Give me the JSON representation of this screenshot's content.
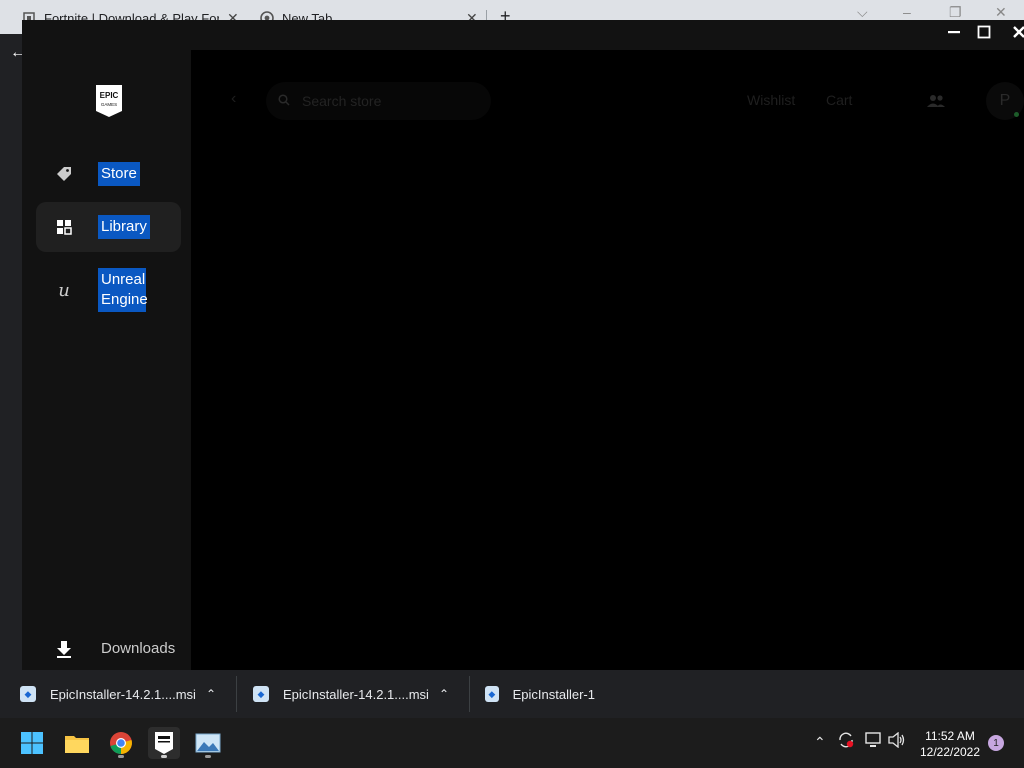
{
  "chrome": {
    "tabs": [
      {
        "title": "Fortnite | Download & Play For F",
        "favicon": "fortnite-icon"
      },
      {
        "title": "New Tab",
        "favicon": "chrome-icon"
      }
    ],
    "new_tab_glyph": "+"
  },
  "epic": {
    "logo_text": "EPIC",
    "logo_sub": "GAMES",
    "sidebar": {
      "items": [
        {
          "label": "Store",
          "icon": "tag-icon"
        },
        {
          "label": "Library",
          "icon": "grid-icon"
        },
        {
          "label": "Unreal Engine",
          "icon": "unreal-icon"
        }
      ],
      "downloads_label": "Downloads"
    },
    "header": {
      "search_placeholder": "Search store",
      "wishlist": "Wishlist",
      "cart": "Cart",
      "avatar_letter": "P"
    }
  },
  "downloads_bar": {
    "items": [
      {
        "name": "EpicInstaller-14.2.1....msi"
      },
      {
        "name": "EpicInstaller-14.2.1....msi"
      },
      {
        "name": "EpicInstaller-1"
      }
    ]
  },
  "taskbar": {
    "apps": [
      "windows-start-icon",
      "file-explorer-icon",
      "chrome-icon",
      "epic-games-icon",
      "image-viewer-icon"
    ],
    "clock_time": "11:52 AM",
    "clock_date": "12/22/2022",
    "notification_count": "1"
  },
  "colors": {
    "selection_blue": "#0a58c2",
    "launcher_bg": "#121212",
    "content_bg": "#000000"
  }
}
